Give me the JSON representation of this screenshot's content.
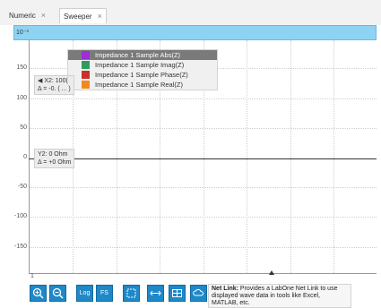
{
  "tabs": [
    {
      "label": "Numeric",
      "close": "×"
    },
    {
      "label": "Sweeper",
      "close": "×"
    }
  ],
  "plot": {
    "y_exponent": "10⁻³",
    "y_ticks": [
      "150",
      "100",
      "50",
      "0",
      "-50",
      "-100",
      "-150"
    ],
    "x_tick_left": "1",
    "legend": [
      {
        "label": "Impedance 1 Sample Abs(Z)",
        "color": "#9c2fd6",
        "selected": true
      },
      {
        "label": "Impedance 1 Sample Imag(Z)",
        "color": "#2e9c5a",
        "selected": false
      },
      {
        "label": "Impedance 1 Sample Phase(Z)",
        "color": "#c9302c",
        "selected": false
      },
      {
        "label": "Impedance 1 Sample Real(Z)",
        "color": "#f08a1d",
        "selected": false
      }
    ],
    "cursor_x2": {
      "line1": "◀ X2: 100(",
      "line2": "Δ = -0. ( ... )"
    },
    "cursor_y2": {
      "line1": "Y2: 0 Ohm",
      "line2": "Δ = +0 Ohm"
    }
  },
  "toolbar": {
    "buttons": [
      "zoom-in",
      "zoom-out",
      "Log",
      "FS",
      "select-icon",
      "fit-icon",
      "table-icon",
      "cloud-icon"
    ],
    "log_label": "Log",
    "fs_label": "FS"
  },
  "tooltip": {
    "title": "Net Link:",
    "text": "Provides a LabOne Net Link to use displayed wave data in tools like Excel, MATLAB, etc."
  }
}
